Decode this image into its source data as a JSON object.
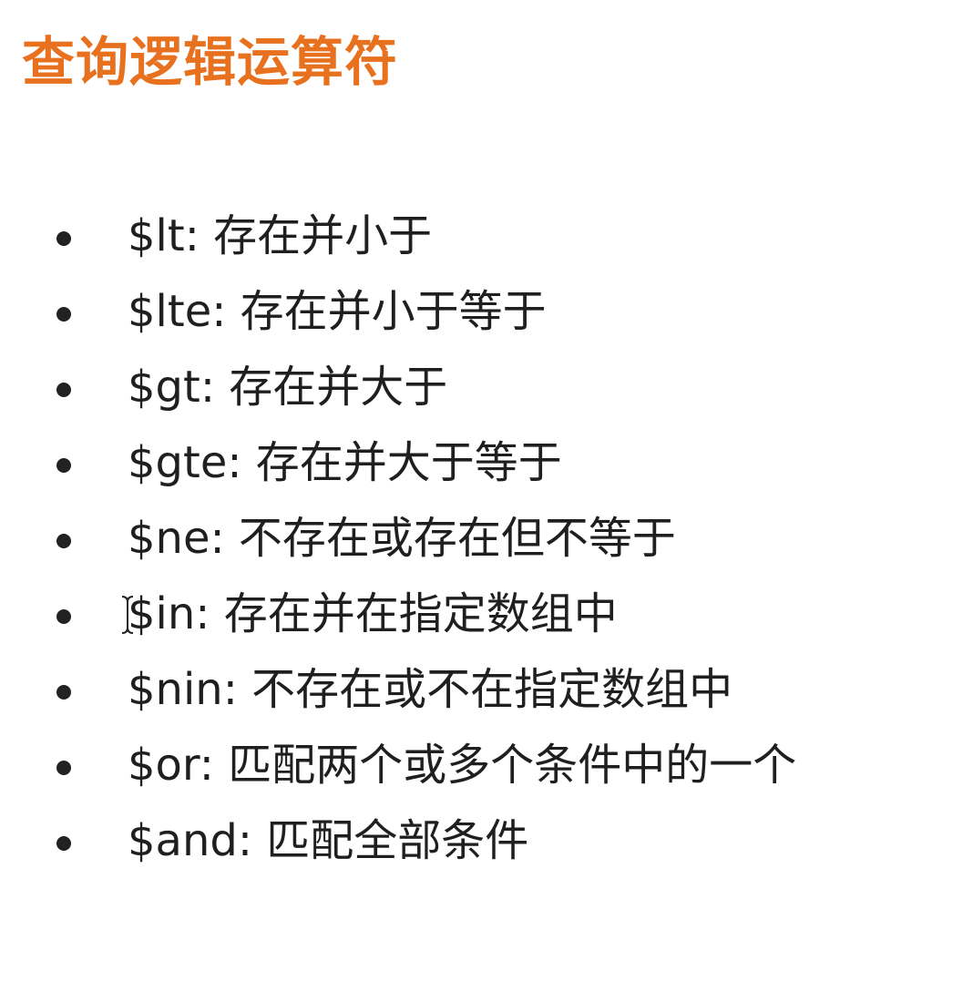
{
  "title": "查询逻辑运算符",
  "colors": {
    "title": "#e8711f",
    "text": "#1f1f1f",
    "bullet": "#222222"
  },
  "items": [
    {
      "text": "$lt: 存在并小于"
    },
    {
      "text": "$lte: 存在并小于等于"
    },
    {
      "text": "$gt: 存在并大于"
    },
    {
      "text": "$gte: 存在并大于等于"
    },
    {
      "text": "$ne: 不存在或存在但不等于"
    },
    {
      "text": "$in: 存在并在指定数组中"
    },
    {
      "text": "$nin: 不存在或不在指定数组中"
    },
    {
      "text": "$or: 匹配两个或多个条件中的一个"
    },
    {
      "text": "$and: 匹配全部条件"
    }
  ],
  "cursor_icon": "text-cursor-icon"
}
